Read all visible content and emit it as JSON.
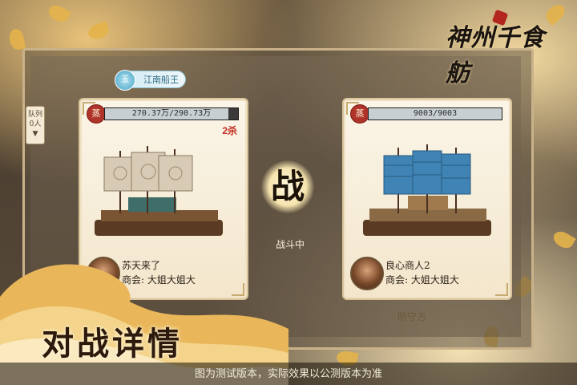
{
  "game": {
    "logo_text": "神州千食舫"
  },
  "badge": {
    "icon": "jade-icon",
    "icon_text": "玉",
    "label": "江南船王"
  },
  "queue": {
    "line1": "队列",
    "line2": "0人"
  },
  "attacker": {
    "seal": "蒸",
    "hp_text": "270.37万/290.73万",
    "hp_fraction": 0.93,
    "kills": "2杀",
    "name": "苏天来了",
    "guild": "商会: 大姐大姐大",
    "sail_color": "#d8cbb6"
  },
  "defender": {
    "seal": "蒸",
    "hp_text": "9003/9003",
    "hp_fraction": 1.0,
    "name": "良心商人2",
    "guild": "商会: 大姐大姐大",
    "role_label": "防守方",
    "sail_color": "#3f84b4"
  },
  "battle": {
    "versus_char": "战",
    "state": "战斗中"
  },
  "banner": {
    "title": "对战详情"
  },
  "footer": {
    "disclaimer": "图为测试版本，实际效果以公测版本为准"
  }
}
